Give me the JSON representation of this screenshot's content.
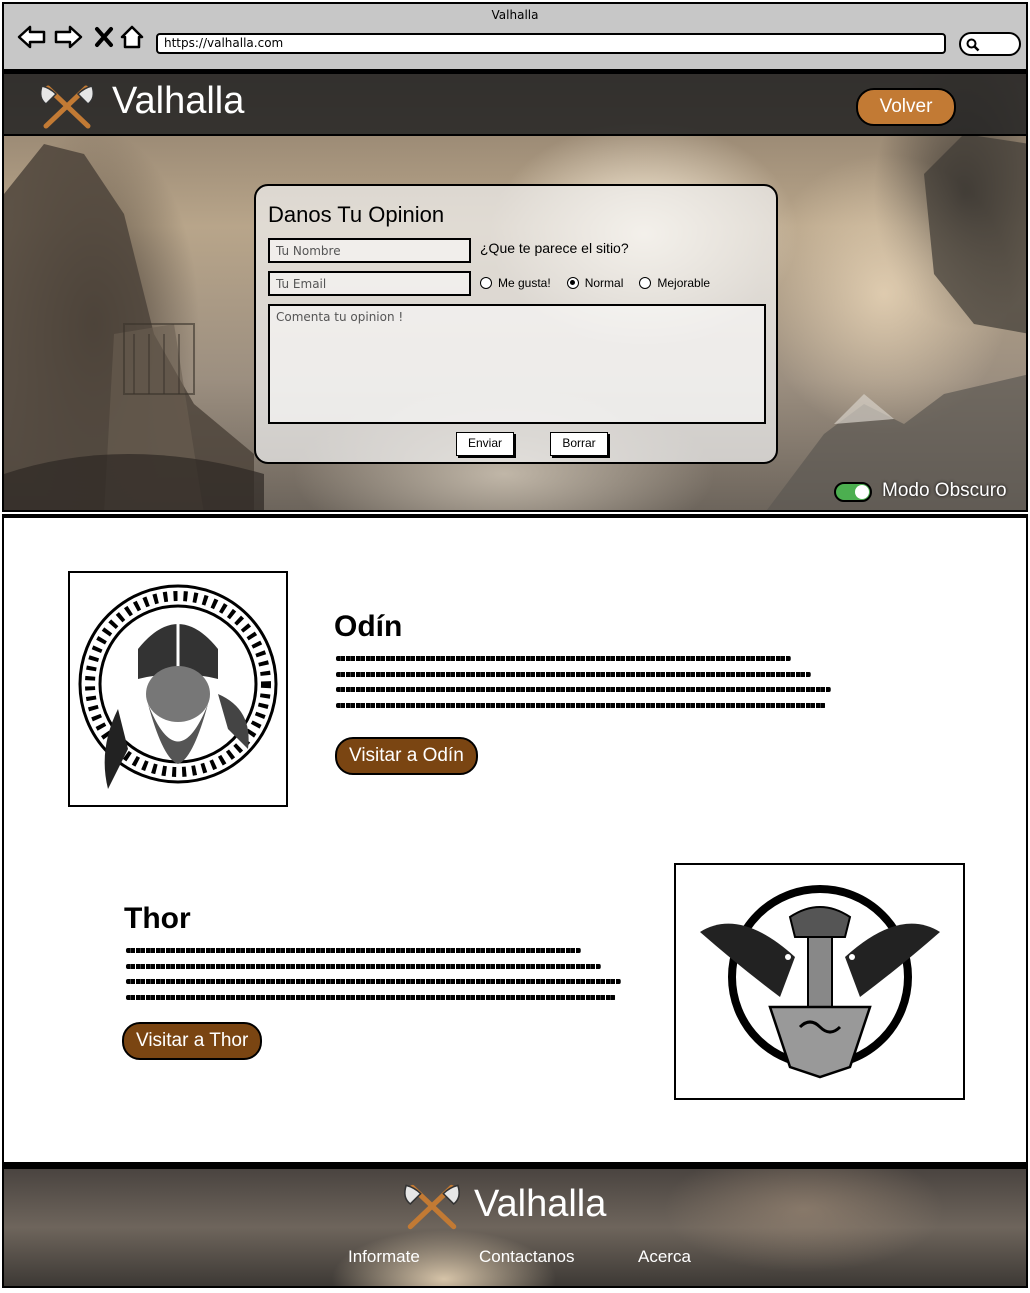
{
  "browser": {
    "window_title": "Valhalla",
    "url": "https://valhalla.com"
  },
  "header": {
    "brand": "Valhalla",
    "back_label": "Volver",
    "accent_color": "#c27a34"
  },
  "feedback": {
    "title": "Danos Tu Opinion",
    "name_placeholder": "Tu Nombre",
    "email_placeholder": "Tu Email",
    "question": "¿Que te parece el sitio?",
    "options": [
      "Me gusta!",
      "Normal",
      "Mejorable"
    ],
    "selected_option": "Normal",
    "comment_placeholder": "Comenta tu opinion !",
    "submit_label": "Enviar",
    "reset_label": "Borrar"
  },
  "dark_mode": {
    "label": "Modo Obscuro",
    "enabled": true,
    "toggle_color": "#4caf50"
  },
  "gods": [
    {
      "name": "Odín",
      "button_label": "Visitar a Odín",
      "icon": "odin-portrait-icon"
    },
    {
      "name": "Thor",
      "button_label": "Visitar a Thor",
      "icon": "mjolnir-ravens-icon"
    }
  ],
  "god_button_color": "#7a4512",
  "footer": {
    "brand": "Valhalla",
    "links": [
      "Informate",
      "Contactanos",
      "Acerca"
    ]
  }
}
